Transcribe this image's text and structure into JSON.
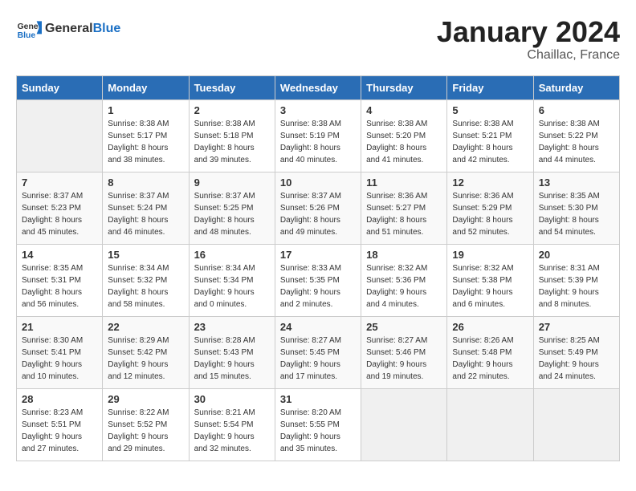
{
  "header": {
    "logo_general": "General",
    "logo_blue": "Blue",
    "month_title": "January 2024",
    "location": "Chaillac, France"
  },
  "weekdays": [
    "Sunday",
    "Monday",
    "Tuesday",
    "Wednesday",
    "Thursday",
    "Friday",
    "Saturday"
  ],
  "weeks": [
    [
      {
        "day": "",
        "sunrise": "",
        "sunset": "",
        "daylight": ""
      },
      {
        "day": "1",
        "sunrise": "Sunrise: 8:38 AM",
        "sunset": "Sunset: 5:17 PM",
        "daylight": "Daylight: 8 hours and 38 minutes."
      },
      {
        "day": "2",
        "sunrise": "Sunrise: 8:38 AM",
        "sunset": "Sunset: 5:18 PM",
        "daylight": "Daylight: 8 hours and 39 minutes."
      },
      {
        "day": "3",
        "sunrise": "Sunrise: 8:38 AM",
        "sunset": "Sunset: 5:19 PM",
        "daylight": "Daylight: 8 hours and 40 minutes."
      },
      {
        "day": "4",
        "sunrise": "Sunrise: 8:38 AM",
        "sunset": "Sunset: 5:20 PM",
        "daylight": "Daylight: 8 hours and 41 minutes."
      },
      {
        "day": "5",
        "sunrise": "Sunrise: 8:38 AM",
        "sunset": "Sunset: 5:21 PM",
        "daylight": "Daylight: 8 hours and 42 minutes."
      },
      {
        "day": "6",
        "sunrise": "Sunrise: 8:38 AM",
        "sunset": "Sunset: 5:22 PM",
        "daylight": "Daylight: 8 hours and 44 minutes."
      }
    ],
    [
      {
        "day": "7",
        "sunrise": "Sunrise: 8:37 AM",
        "sunset": "Sunset: 5:23 PM",
        "daylight": "Daylight: 8 hours and 45 minutes."
      },
      {
        "day": "8",
        "sunrise": "Sunrise: 8:37 AM",
        "sunset": "Sunset: 5:24 PM",
        "daylight": "Daylight: 8 hours and 46 minutes."
      },
      {
        "day": "9",
        "sunrise": "Sunrise: 8:37 AM",
        "sunset": "Sunset: 5:25 PM",
        "daylight": "Daylight: 8 hours and 48 minutes."
      },
      {
        "day": "10",
        "sunrise": "Sunrise: 8:37 AM",
        "sunset": "Sunset: 5:26 PM",
        "daylight": "Daylight: 8 hours and 49 minutes."
      },
      {
        "day": "11",
        "sunrise": "Sunrise: 8:36 AM",
        "sunset": "Sunset: 5:27 PM",
        "daylight": "Daylight: 8 hours and 51 minutes."
      },
      {
        "day": "12",
        "sunrise": "Sunrise: 8:36 AM",
        "sunset": "Sunset: 5:29 PM",
        "daylight": "Daylight: 8 hours and 52 minutes."
      },
      {
        "day": "13",
        "sunrise": "Sunrise: 8:35 AM",
        "sunset": "Sunset: 5:30 PM",
        "daylight": "Daylight: 8 hours and 54 minutes."
      }
    ],
    [
      {
        "day": "14",
        "sunrise": "Sunrise: 8:35 AM",
        "sunset": "Sunset: 5:31 PM",
        "daylight": "Daylight: 8 hours and 56 minutes."
      },
      {
        "day": "15",
        "sunrise": "Sunrise: 8:34 AM",
        "sunset": "Sunset: 5:32 PM",
        "daylight": "Daylight: 8 hours and 58 minutes."
      },
      {
        "day": "16",
        "sunrise": "Sunrise: 8:34 AM",
        "sunset": "Sunset: 5:34 PM",
        "daylight": "Daylight: 9 hours and 0 minutes."
      },
      {
        "day": "17",
        "sunrise": "Sunrise: 8:33 AM",
        "sunset": "Sunset: 5:35 PM",
        "daylight": "Daylight: 9 hours and 2 minutes."
      },
      {
        "day": "18",
        "sunrise": "Sunrise: 8:32 AM",
        "sunset": "Sunset: 5:36 PM",
        "daylight": "Daylight: 9 hours and 4 minutes."
      },
      {
        "day": "19",
        "sunrise": "Sunrise: 8:32 AM",
        "sunset": "Sunset: 5:38 PM",
        "daylight": "Daylight: 9 hours and 6 minutes."
      },
      {
        "day": "20",
        "sunrise": "Sunrise: 8:31 AM",
        "sunset": "Sunset: 5:39 PM",
        "daylight": "Daylight: 9 hours and 8 minutes."
      }
    ],
    [
      {
        "day": "21",
        "sunrise": "Sunrise: 8:30 AM",
        "sunset": "Sunset: 5:41 PM",
        "daylight": "Daylight: 9 hours and 10 minutes."
      },
      {
        "day": "22",
        "sunrise": "Sunrise: 8:29 AM",
        "sunset": "Sunset: 5:42 PM",
        "daylight": "Daylight: 9 hours and 12 minutes."
      },
      {
        "day": "23",
        "sunrise": "Sunrise: 8:28 AM",
        "sunset": "Sunset: 5:43 PM",
        "daylight": "Daylight: 9 hours and 15 minutes."
      },
      {
        "day": "24",
        "sunrise": "Sunrise: 8:27 AM",
        "sunset": "Sunset: 5:45 PM",
        "daylight": "Daylight: 9 hours and 17 minutes."
      },
      {
        "day": "25",
        "sunrise": "Sunrise: 8:27 AM",
        "sunset": "Sunset: 5:46 PM",
        "daylight": "Daylight: 9 hours and 19 minutes."
      },
      {
        "day": "26",
        "sunrise": "Sunrise: 8:26 AM",
        "sunset": "Sunset: 5:48 PM",
        "daylight": "Daylight: 9 hours and 22 minutes."
      },
      {
        "day": "27",
        "sunrise": "Sunrise: 8:25 AM",
        "sunset": "Sunset: 5:49 PM",
        "daylight": "Daylight: 9 hours and 24 minutes."
      }
    ],
    [
      {
        "day": "28",
        "sunrise": "Sunrise: 8:23 AM",
        "sunset": "Sunset: 5:51 PM",
        "daylight": "Daylight: 9 hours and 27 minutes."
      },
      {
        "day": "29",
        "sunrise": "Sunrise: 8:22 AM",
        "sunset": "Sunset: 5:52 PM",
        "daylight": "Daylight: 9 hours and 29 minutes."
      },
      {
        "day": "30",
        "sunrise": "Sunrise: 8:21 AM",
        "sunset": "Sunset: 5:54 PM",
        "daylight": "Daylight: 9 hours and 32 minutes."
      },
      {
        "day": "31",
        "sunrise": "Sunrise: 8:20 AM",
        "sunset": "Sunset: 5:55 PM",
        "daylight": "Daylight: 9 hours and 35 minutes."
      },
      {
        "day": "",
        "sunrise": "",
        "sunset": "",
        "daylight": ""
      },
      {
        "day": "",
        "sunrise": "",
        "sunset": "",
        "daylight": ""
      },
      {
        "day": "",
        "sunrise": "",
        "sunset": "",
        "daylight": ""
      }
    ]
  ]
}
